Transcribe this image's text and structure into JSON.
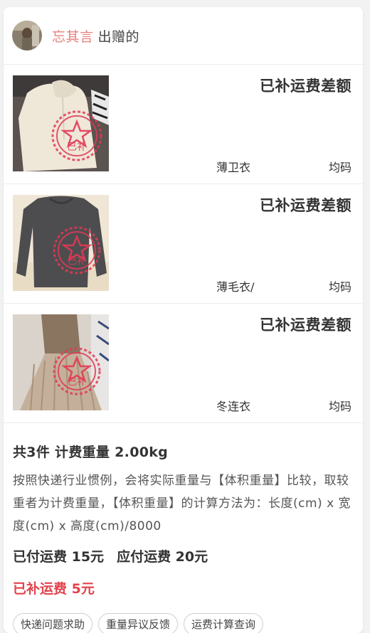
{
  "header": {
    "username": "忘其言",
    "action": "出赠的"
  },
  "items": [
    {
      "badge": "已补运费差额",
      "name": "薄卫衣",
      "size": "均码",
      "stamp": "已补"
    },
    {
      "badge": "已补运费差额",
      "name": "薄毛衣/",
      "size": "均码",
      "stamp": "已补"
    },
    {
      "badge": "已补运费差额",
      "name": "冬连衣",
      "size": "均码",
      "stamp": "已补"
    }
  ],
  "summary": {
    "title": "共3件 计费重量 2.00kg",
    "description": "按照快递行业惯例，会将实际重量与【体积重量】比较，取较重者为计费重量，【体积重量】的计算方法为：长度(cm) x 宽度(cm) x 高度(cm)/8000",
    "paid": "已付运费 15元",
    "payable": "应付运费 20元",
    "extra": "已补运费 5元"
  },
  "actions": [
    "快递问题求助",
    "重量异议反馈",
    "运费计算查询"
  ],
  "colors": {
    "username": "#e8817f",
    "highlight": "#e2434c",
    "stamp": "#e23a55"
  }
}
